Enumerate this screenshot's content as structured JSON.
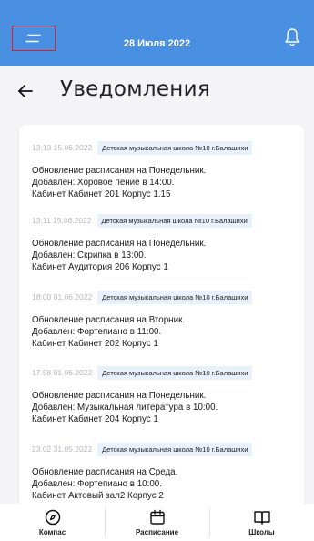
{
  "header": {
    "date": "28 Июля 2022",
    "menu_icon": "menu-icon",
    "bell_icon": "bell-icon",
    "accent": "#4a90e2"
  },
  "page": {
    "title": "Уведомления",
    "back_icon": "arrow-left-icon"
  },
  "notifications": [
    {
      "time": "13:13 15.06.2022",
      "school": "Детская музыкальная школа №10 г.Балашихи",
      "line1": "Обновление расписания на Понедельник.",
      "line2": "Добавлен: Хоровое пение в 14:00.",
      "line3": "Кабинет Кабинет 201 Корпус 1.15"
    },
    {
      "time": "13:11 15.06.2022",
      "school": "Детская музыкальная школа №10 г.Балашихи",
      "line1": "Обновление расписания на Понедельник.",
      "line2": "Добавлен: Скрипка в 13:00.",
      "line3": "Кабинет Аудитория 206 Корпус 1"
    },
    {
      "time": "18:00 01.06.2022",
      "school": "Детская музыкальная школа №10 г.Балашихи",
      "line1": "Обновление расписания на Вторник.",
      "line2": "Добавлен: Фортепиано в 11:00.",
      "line3": "Кабинет Кабинет 202 Корпус 1"
    },
    {
      "time": "17:58 01.06.2022",
      "school": "Детская музыкальная школа №10 г.Балашихи",
      "line1": "Обновление расписания на Понедельник.",
      "line2": "Добавлен: Музыкальная литература в 10:00.",
      "line3": "Кабинет Кабинет 204 Корпус 1"
    },
    {
      "time": "23:02 31.05.2022",
      "school": "Детская музыкальная школа №10 г.Балашихи",
      "line1": "Обновление расписания на Среда.",
      "line2": "Добавлен: Фортепиано в 10:00.",
      "line3": "Кабинет Актовый зал2 Корпус 2"
    }
  ],
  "bottom_nav": [
    {
      "label": "Компас",
      "icon": "compass-icon"
    },
    {
      "label": "Расписание",
      "icon": "calendar-icon"
    },
    {
      "label": "Школы",
      "icon": "book-icon"
    }
  ]
}
